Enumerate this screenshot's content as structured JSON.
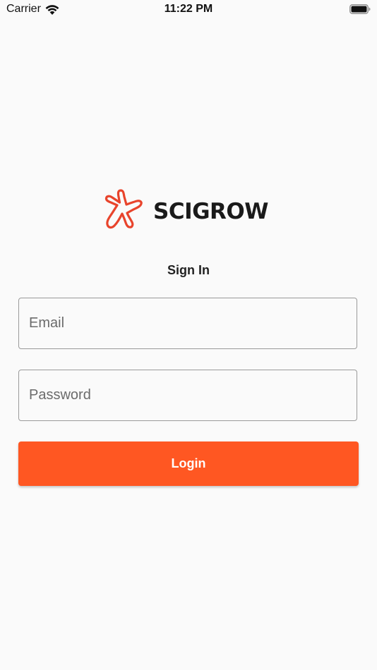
{
  "status_bar": {
    "carrier": "Carrier",
    "time": "11:22 PM",
    "wifi_icon": "wifi-icon",
    "battery_icon": "battery-icon"
  },
  "logo": {
    "brand_name": "SCIGROW",
    "mark_icon": "starfish-logo-icon",
    "mark_color": "#e8442c"
  },
  "sign_in": {
    "title": "Sign In"
  },
  "form": {
    "email": {
      "value": "",
      "placeholder": "Email"
    },
    "password": {
      "value": "",
      "placeholder": "Password"
    },
    "login_label": "Login"
  },
  "colors": {
    "background": "#fafafa",
    "accent": "#ff5722",
    "field_border": "#9a9a9a"
  }
}
